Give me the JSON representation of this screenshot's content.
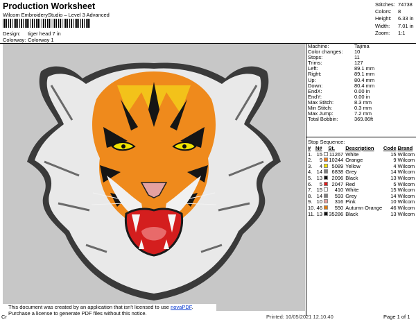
{
  "header": {
    "title": "Production Worksheet",
    "subtitle": "Wilcom EmbroideryStudio – Level 3 Advanced",
    "design_label": "Design:",
    "design_value": "tiger head 7 in",
    "colorway_label": "Colorway:",
    "colorway_value": "Colorway 1"
  },
  "stats_top": [
    {
      "label": "Stitches:",
      "value": "74738"
    },
    {
      "label": "Colors:",
      "value": "8"
    },
    {
      "label": "Height:",
      "value": "6.33 in"
    },
    {
      "label": "Width:",
      "value": "7.01 in"
    },
    {
      "label": "Zoom:",
      "value": "1:1"
    }
  ],
  "machine_info": [
    {
      "label": "Machine:",
      "value": "Tajima"
    },
    {
      "label": "Color changes:",
      "value": "10"
    },
    {
      "label": "Stops:",
      "value": "11"
    },
    {
      "label": "Trims:",
      "value": "127"
    },
    {
      "label": "Left:",
      "value": "89.1 mm"
    },
    {
      "label": "Right:",
      "value": "89.1 mm"
    },
    {
      "label": "Up:",
      "value": "80.4 mm"
    },
    {
      "label": "Down:",
      "value": "80.4 mm"
    },
    {
      "label": "EndX:",
      "value": "0.00 in"
    },
    {
      "label": "EndY:",
      "value": "0.00 in"
    },
    {
      "label": "Max Stitch:",
      "value": "8.3 mm"
    },
    {
      "label": "Min Stitch:",
      "value": "0.3 mm"
    },
    {
      "label": "Max Jump:",
      "value": "7.2 mm"
    },
    {
      "label": "Total Bobbin:",
      "value": "369.86ft"
    }
  ],
  "stop_sequence": {
    "heading": "Stop Sequence:",
    "columns": [
      "#",
      "N#",
      "St.",
      "Description",
      "Code",
      "Brand"
    ],
    "rows": [
      {
        "num": "1.",
        "n": "15",
        "color": "#ffffff",
        "st": "11267",
        "desc": "White",
        "code": "15",
        "brand": "Wilcom"
      },
      {
        "num": "2.",
        "n": "9",
        "color": "#f07a1a",
        "st": "10244",
        "desc": "Orange",
        "code": "9",
        "brand": "Wilcom"
      },
      {
        "num": "3.",
        "n": "4",
        "color": "#f6e200",
        "st": "5089",
        "desc": "Yellow",
        "code": "4",
        "brand": "Wilcom"
      },
      {
        "num": "4.",
        "n": "14",
        "color": "#7f7f7f",
        "st": "6838",
        "desc": "Grey",
        "code": "14",
        "brand": "Wilcom"
      },
      {
        "num": "5.",
        "n": "13",
        "color": "#101010",
        "st": "2096",
        "desc": "Black",
        "code": "13",
        "brand": "Wilcom"
      },
      {
        "num": "6.",
        "n": "5",
        "color": "#e21b1b",
        "st": "2047",
        "desc": "Red",
        "code": "5",
        "brand": "Wilcom"
      },
      {
        "num": "7.",
        "n": "15",
        "color": "#ffffff",
        "st": "410",
        "desc": "White",
        "code": "15",
        "brand": "Wilcom"
      },
      {
        "num": "8.",
        "n": "14",
        "color": "#7f7f7f",
        "st": "593",
        "desc": "Grey",
        "code": "14",
        "brand": "Wilcom"
      },
      {
        "num": "9.",
        "n": "10",
        "color": "#e8a0a0",
        "st": "316",
        "desc": "Pink",
        "code": "10",
        "brand": "Wilcom"
      },
      {
        "num": "10.",
        "n": "46",
        "color": "#e07a10",
        "st": "550",
        "desc": "Autumn Orange",
        "code": "46",
        "brand": "Wilcom"
      },
      {
        "num": "11.",
        "n": "13",
        "color": "#101010",
        "st": "35286",
        "desc": "Black",
        "code": "13",
        "brand": "Wilcom"
      }
    ]
  },
  "footer": {
    "notice_line1": "This document was created by an application that isn't licensed to use ",
    "notice_link": "novaPDF",
    "notice_line1_end": ".",
    "notice_line2": "Purchase a license to generate PDF files without this notice.",
    "cr": "Cr",
    "printed": "Printed: 10/05/2021 12.10.40",
    "page": "Page 1 of 1"
  }
}
